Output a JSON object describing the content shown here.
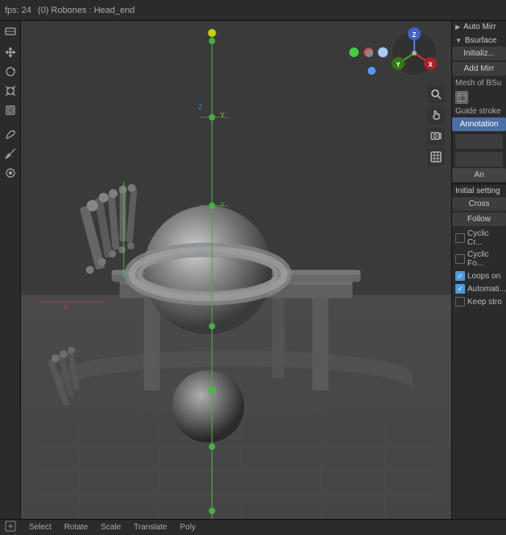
{
  "header": {
    "fps_label": "fps: 24",
    "bone_info": "(0) Robones : Head_end"
  },
  "toolbar": {
    "icons": [
      "cursor",
      "move",
      "rotate",
      "scale",
      "transform",
      "annotate",
      "measure",
      "grease-pencil"
    ]
  },
  "nav_gizmo": {
    "x_label": "X",
    "y_label": "Y",
    "z_label": "Z",
    "x_color": "#e05050",
    "y_color": "#80c040",
    "z_color": "#5080e0"
  },
  "right_panel": {
    "auto_mirror_label": "Auto Mirr",
    "bsurface_label": "Bsurface",
    "initialize_label": "Initializ...",
    "add_mirror_label": "Add Mirr",
    "mesh_label": "Mesh of BSu",
    "guide_stroke_label": "Guide stroke",
    "annotation_label": "Annotation",
    "initial_settings_label": "Initial setting",
    "cross_label": "Cross",
    "follow_label": "Follow",
    "cyclic_cross_label": "Cyclic Cr...",
    "cyclic_follow_label": "Cyclic Fo...",
    "loops_on_label": "Loops on",
    "automatic_label": "Automati...",
    "keep_stro_label": "Keep stro",
    "loops_on_checked": true,
    "automatic_checked": true,
    "keep_stro_checked": false,
    "cyclic_cross_checked": false,
    "cyclic_follow_checked": false
  },
  "status_bar": {
    "items": [
      "Select",
      "Rotate",
      "Scale",
      "Translate",
      "Poly"
    ]
  },
  "viewport_icons": [
    "magnify",
    "hand",
    "camera",
    "grid"
  ]
}
